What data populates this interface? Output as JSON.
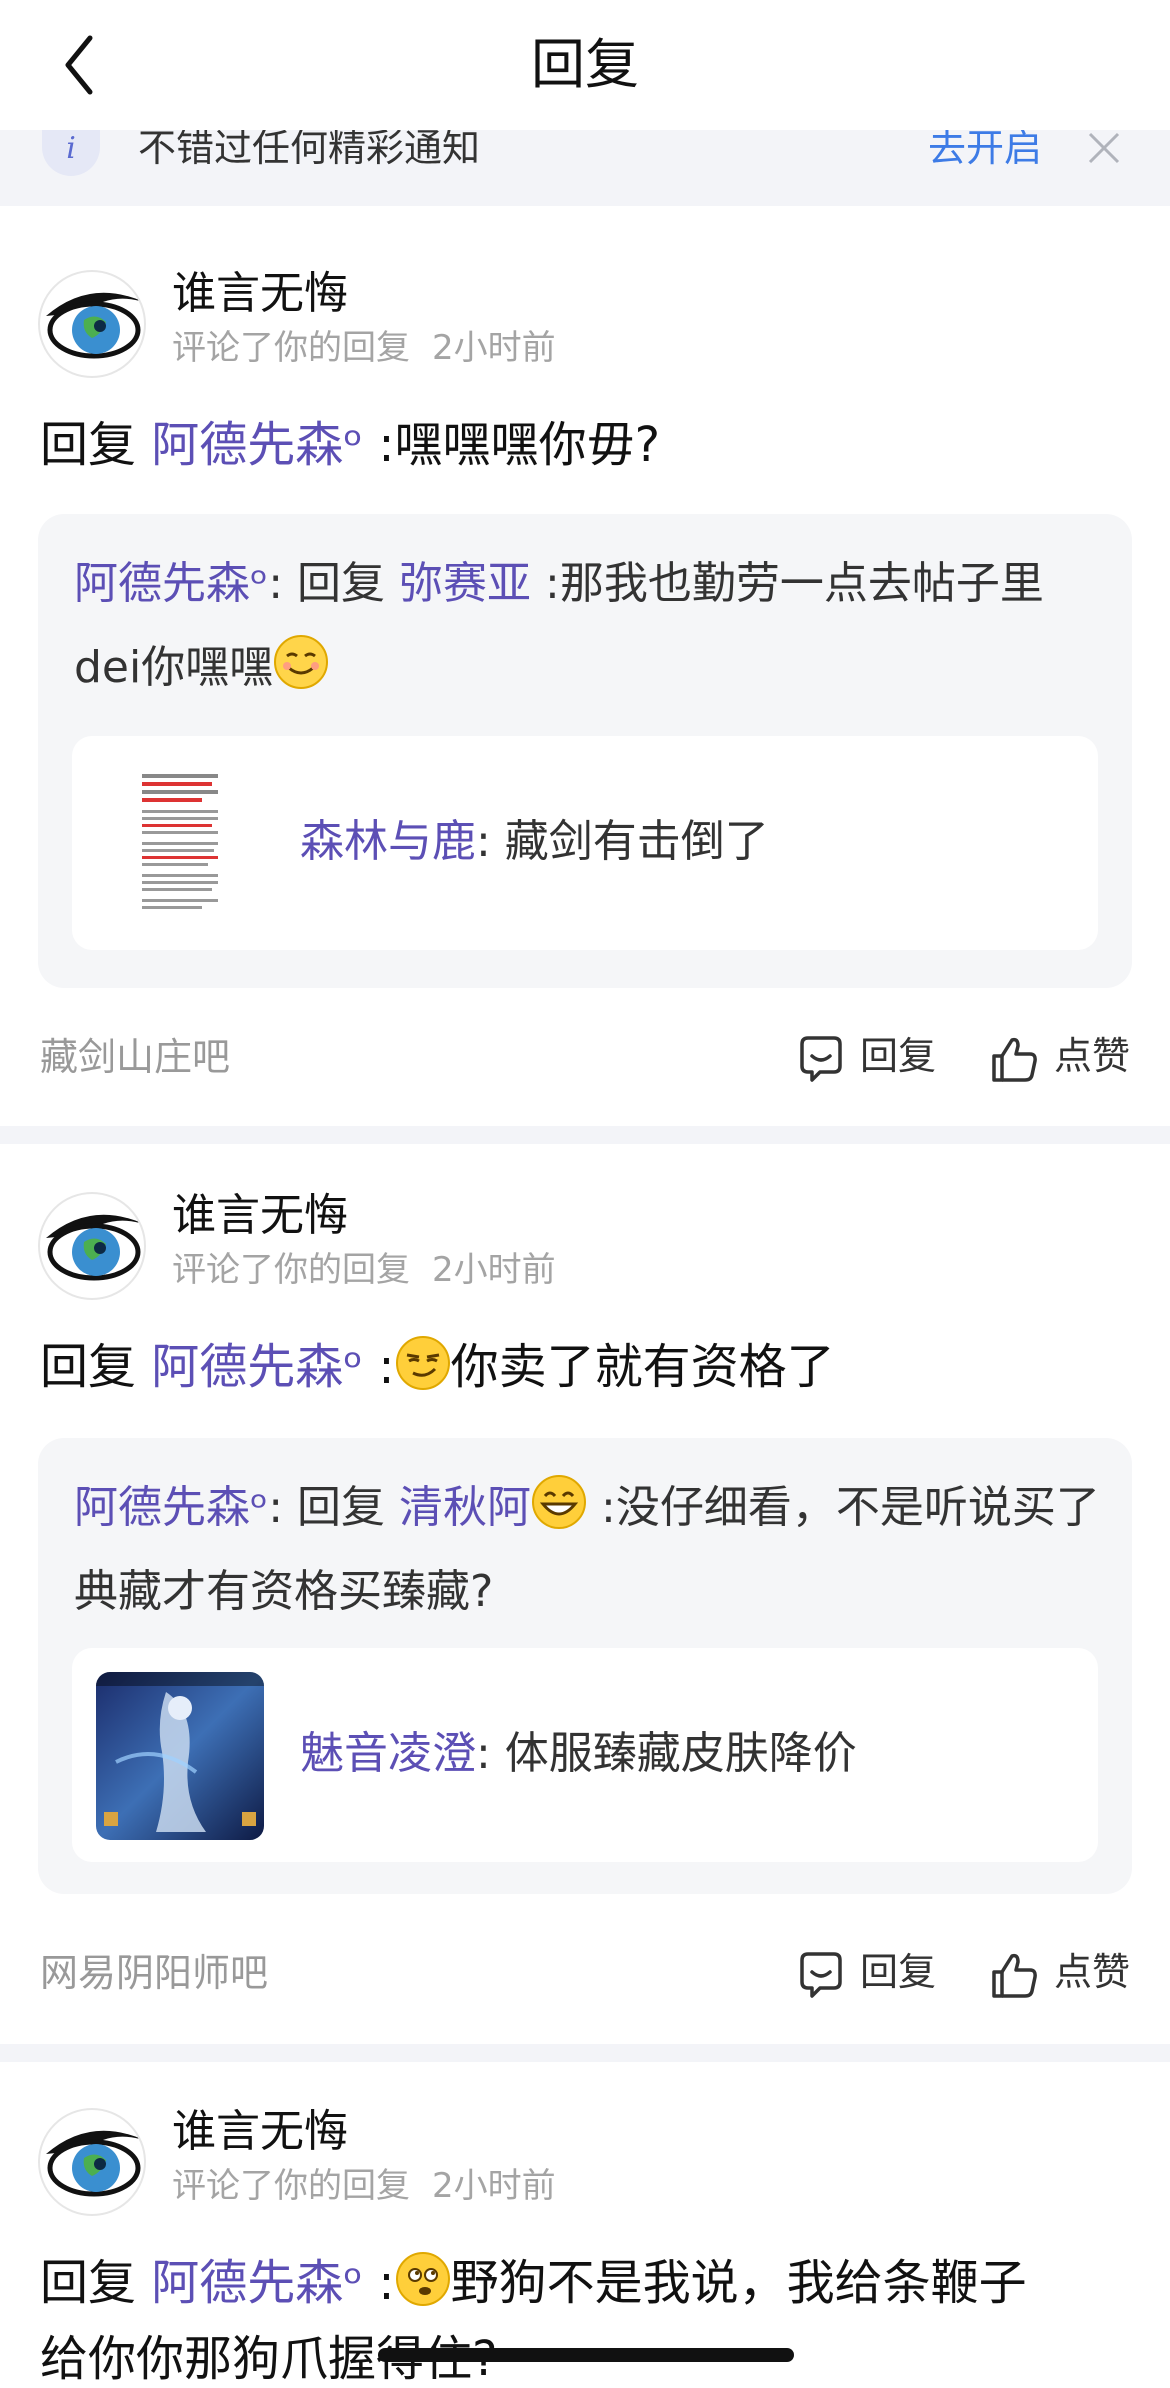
{
  "header": {
    "title": "回复"
  },
  "notice": {
    "text": "不错过任何精彩通知",
    "open_label": "去开启"
  },
  "actions": {
    "reply": "回复",
    "like": "点赞"
  },
  "items": [
    {
      "user": "谁言无悔",
      "action": "评论了你的回复",
      "time": "2小时前",
      "reply_prefix": "回复",
      "reply_to": "阿德先森ᵒ",
      "reply_body": ":嘿嘿嘿你毋?",
      "quote": {
        "author": "阿德先森ᵒ",
        "mid": ": 回复",
        "target": "弥赛亚",
        "text": ":那我也勤劳一点去帖子里dei你嘿嘿",
        "emoji": "smiling-face"
      },
      "post": {
        "author": "森林与鹿",
        "title": ": 藏剑有击倒了"
      },
      "forum": "藏剑山庄吧"
    },
    {
      "user": "谁言无悔",
      "action": "评论了你的回复",
      "time": "2小时前",
      "reply_prefix": "回复",
      "reply_to": "阿德先森ᵒ",
      "reply_body": "你卖了就有资格了",
      "quote": {
        "author": "阿德先森ᵒ",
        "mid": ": 回复",
        "target": "清秋阿",
        "text": ":没仔细看，不是听说买了典藏才有资格买臻藏?"
      },
      "post": {
        "author": "魅音凌澄",
        "title": ": 体服臻藏皮肤降价"
      },
      "forum": "网易阴阳师吧"
    },
    {
      "user": "谁言无悔",
      "action": "评论了你的回复",
      "time": "2小时前",
      "reply_prefix": "回复",
      "reply_to": "阿德先森ᵒ",
      "reply_body_line1": "野狗不是我说，我给条鞭子",
      "reply_body_line2": "给你你那狗爪握得住?"
    }
  ],
  "colors": {
    "link": "#5c4fb5",
    "accent": "#3d7be6",
    "separator": "#f3f4f8",
    "quote_bg": "#f5f6f8"
  }
}
